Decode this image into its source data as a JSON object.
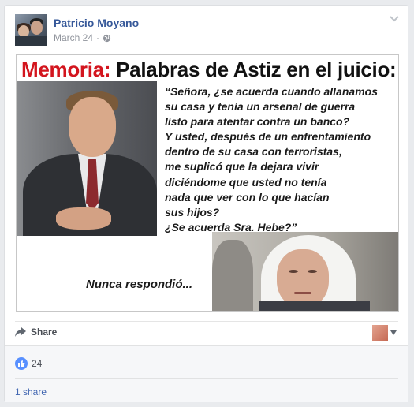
{
  "post": {
    "author": "Patricio Moyano",
    "date": "March 24",
    "separator": "·",
    "privacy_icon": "globe-icon",
    "options_icon": "chevron-down-icon"
  },
  "image": {
    "headline_red": "Memoria:",
    "headline_dark": " Palabras de Astiz en el juicio:",
    "quote_lines": [
      "“Señora, ¿se acuerda cuando allanamos",
      "su casa y tenía un arsenal de guerra",
      "listo para atentar contra un banco?",
      "Y usted, después de un enfrentamiento",
      "dentro de su casa con terroristas,",
      "me suplicó que la dejara vivir",
      "diciéndome que usted no tenía",
      "nada que ver con lo que hacían",
      "sus hijos?",
      "¿Se acuerda Sra. Hebe?”"
    ],
    "caption": "Nunca respondió..."
  },
  "actions": {
    "share_label": "Share",
    "share_icon": "share-arrow-icon",
    "viewer_icon": "caret-down-icon"
  },
  "stats": {
    "like_icon": "thumbs-up-icon",
    "like_count": "24",
    "shares_label": "1 share"
  },
  "colors": {
    "author_link": "#365899",
    "headline_red": "#d3151e",
    "like_blue": "#5890ff",
    "share_link": "#4267b2"
  }
}
